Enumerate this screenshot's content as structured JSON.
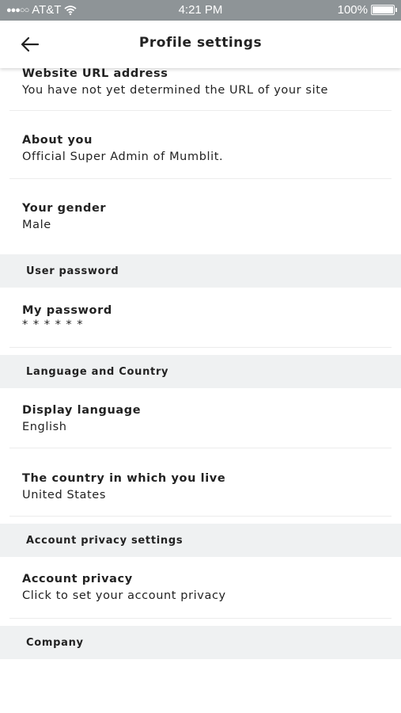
{
  "status_bar": {
    "signal": "●●●○○",
    "carrier": "AT&T",
    "time": "4:21 PM",
    "battery": "100%"
  },
  "header": {
    "title": "Profile settings"
  },
  "items": {
    "website": {
      "label": "Website URL address",
      "value": "You have not yet determined the URL of your site"
    },
    "about": {
      "label": "About you",
      "value": "Official Super Admin of Mumblit."
    },
    "gender": {
      "label": "Your gender",
      "value": "Male"
    },
    "password": {
      "label": "My password",
      "value": "* * * * * *"
    },
    "language": {
      "label": "Display language",
      "value": "English"
    },
    "country": {
      "label": "The country in which you live",
      "value": "United States"
    },
    "privacy": {
      "label": "Account privacy",
      "value": "Click to set your account privacy"
    }
  },
  "sections": {
    "user_password": "User password",
    "language_country": "Language and Country",
    "account_privacy": "Account privacy settings",
    "company": "Company"
  }
}
